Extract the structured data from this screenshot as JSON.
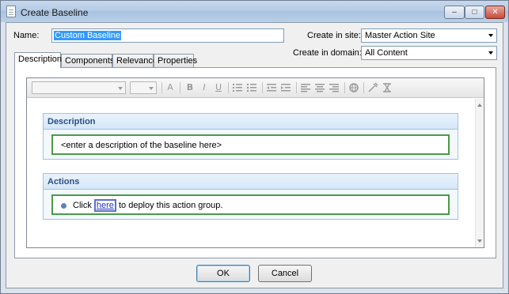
{
  "window": {
    "title": "Create Baseline",
    "minimize_glyph": "‒",
    "maximize_glyph": "□",
    "close_glyph": "✕"
  },
  "form": {
    "name_label": "Name:",
    "name_value": "Custom Baseline",
    "site_label": "Create in site:",
    "site_value": "Master Action Site",
    "domain_label": "Create in domain:",
    "domain_value": "All Content"
  },
  "tabs": [
    {
      "label": "Description",
      "active": true
    },
    {
      "label": "Components",
      "active": false
    },
    {
      "label": "Relevance",
      "active": false
    },
    {
      "label": "Properties",
      "active": false
    }
  ],
  "toolbar": {
    "icons": [
      "font-color-icon",
      "bold-icon",
      "italic-icon",
      "underline-icon",
      "numbered-list-icon",
      "bulleted-list-icon",
      "outdent-icon",
      "indent-icon",
      "align-left-icon",
      "align-center-icon",
      "align-right-icon",
      "insert-link-icon",
      "insert-image-icon",
      "remove-format-icon"
    ],
    "glyphs": {
      "font_color": "A",
      "bold": "B",
      "italic": "I",
      "underline": "U"
    }
  },
  "description_section": {
    "heading": "Description",
    "placeholder": "<enter a description of the baseline here>"
  },
  "actions_section": {
    "heading": "Actions",
    "text_before": "Click ",
    "link_text": "here",
    "text_after": " to deploy this action group."
  },
  "buttons": {
    "ok": "OK",
    "cancel": "Cancel"
  },
  "colors": {
    "section_heading": "#2a4f85",
    "section_border": "#9cc3e4",
    "field_border": "#4a9a4a",
    "selection": "#3399ff"
  }
}
